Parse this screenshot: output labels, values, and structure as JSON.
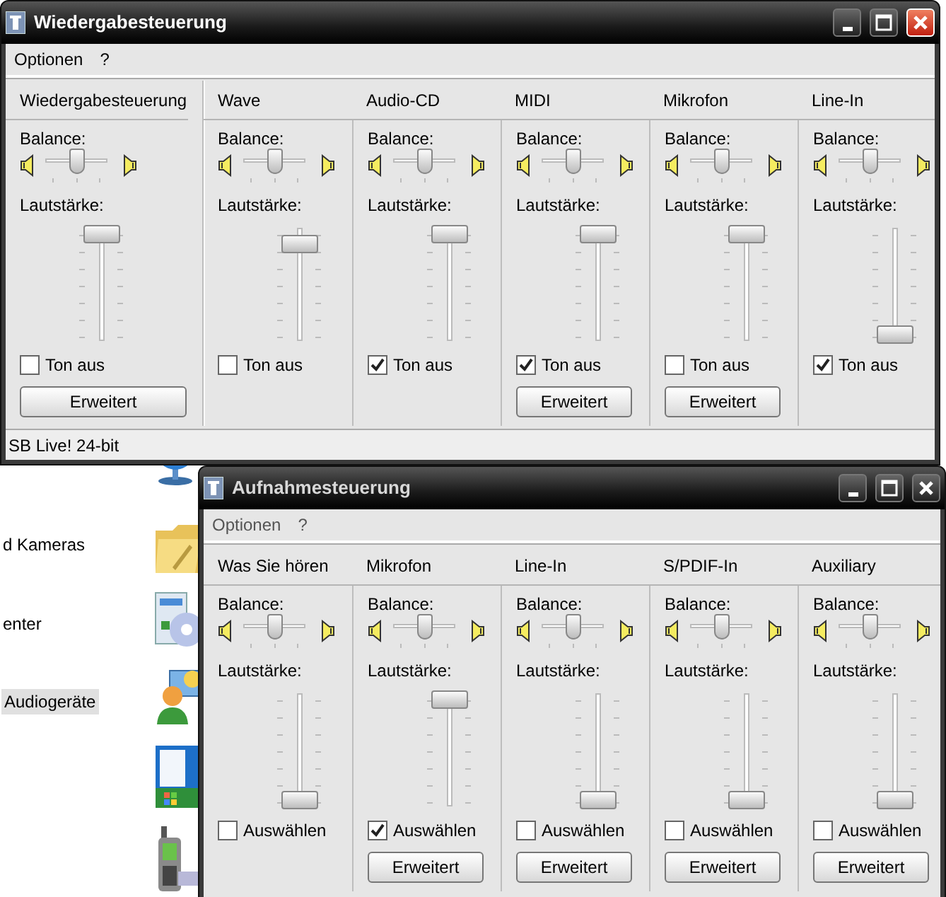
{
  "desktop": {
    "items": [
      {
        "label": "d Kameras",
        "selected": false
      },
      {
        "label": "enter",
        "selected": false
      },
      {
        "label": "Audiogeräte",
        "selected": true
      }
    ]
  },
  "windows": [
    {
      "title": "Wiedergabesteuerung",
      "active": true,
      "menu": [
        "Optionen",
        "?"
      ],
      "status_bar": "SB Live! 24-bit",
      "channels": [
        {
          "kind": "master",
          "name": "Wiedergabesteuerung",
          "balance_label": "Balance:",
          "balance": {
            "level": 0.5
          },
          "volume_label": "Lautstärke:",
          "volume": {
            "level": 1.0
          },
          "check_label": "Ton aus",
          "checked": false,
          "button": "Erweitert"
        },
        {
          "kind": "line",
          "name": "Wave",
          "balance_label": "Balance:",
          "balance": {
            "level": 0.5
          },
          "volume_label": "Lautstärke:",
          "volume": {
            "level": 0.9
          },
          "check_label": "Ton aus",
          "checked": false
        },
        {
          "kind": "line",
          "name": "Audio-CD",
          "balance_label": "Balance:",
          "balance": {
            "level": 0.5
          },
          "volume_label": "Lautstärke:",
          "volume": {
            "level": 1.0
          },
          "check_label": "Ton aus",
          "checked": true
        },
        {
          "kind": "line",
          "name": "MIDI",
          "balance_label": "Balance:",
          "balance": {
            "level": 0.5
          },
          "volume_label": "Lautstärke:",
          "volume": {
            "level": 1.0
          },
          "check_label": "Ton aus",
          "checked": true,
          "button": "Erweitert"
        },
        {
          "kind": "line",
          "name": "Mikrofon",
          "balance_label": "Balance:",
          "balance": {
            "level": 0.5
          },
          "volume_label": "Lautstärke:",
          "volume": {
            "level": 1.0
          },
          "check_label": "Ton aus",
          "checked": false,
          "button": "Erweitert"
        },
        {
          "kind": "line",
          "name": "Line-In",
          "balance_label": "Balance:",
          "balance": {
            "level": 0.5
          },
          "volume_label": "Lautstärke:",
          "volume": {
            "level": 0.0
          },
          "check_label": "Ton aus",
          "checked": true
        }
      ]
    },
    {
      "title": "Aufnahmesteuerung",
      "active": false,
      "menu": [
        "Optionen",
        "?"
      ],
      "channels": [
        {
          "kind": "line",
          "name": "Was Sie hören",
          "balance_label": "Balance:",
          "balance": {
            "level": 0.5
          },
          "volume_label": "Lautstärke:",
          "volume": {
            "level": 0.0
          },
          "check_label": "Auswählen",
          "checked": false
        },
        {
          "kind": "line",
          "name": "Mikrofon",
          "balance_label": "Balance:",
          "balance": {
            "level": 0.5
          },
          "volume_label": "Lautstärke:",
          "volume": {
            "level": 1.0
          },
          "check_label": "Auswählen",
          "checked": true,
          "button": "Erweitert"
        },
        {
          "kind": "line",
          "name": "Line-In",
          "balance_label": "Balance:",
          "balance": {
            "level": 0.5
          },
          "volume_label": "Lautstärke:",
          "volume": {
            "level": 0.0
          },
          "check_label": "Auswählen",
          "checked": false,
          "button": "Erweitert"
        },
        {
          "kind": "line",
          "name": "S/PDIF-In",
          "balance_label": "Balance:",
          "balance": {
            "level": 0.5
          },
          "volume_label": "Lautstärke:",
          "volume": {
            "level": 0.0
          },
          "check_label": "Auswählen",
          "checked": false,
          "button": "Erweitert"
        },
        {
          "kind": "line",
          "name": "Auxiliary",
          "balance_label": "Balance:",
          "balance": {
            "level": 0.5
          },
          "volume_label": "Lautstärke:",
          "volume": {
            "level": 0.0
          },
          "check_label": "Auswählen",
          "checked": false,
          "button": "Erweitert"
        }
      ]
    }
  ]
}
